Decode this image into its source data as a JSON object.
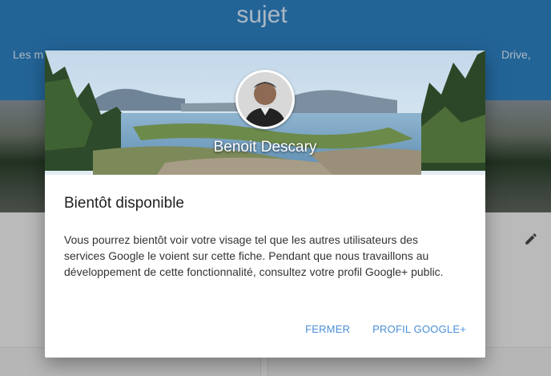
{
  "background": {
    "title": "sujet",
    "subtitle_fragment_left": "Les m",
    "subtitle_fragment_right": "Drive,"
  },
  "dialog": {
    "profile_name": "Benoit Descary",
    "title": "Bientôt disponible",
    "body": "Vous pourrez bientôt voir votre visage tel que les autres utilisateurs des services Google le voient sur cette fiche. Pendant que nous travaillons au développement de cette fonctionnalité, consultez votre profil Google+ public.",
    "buttons": {
      "close": "FERMER",
      "profile": "PROFIL GOOGLE+"
    }
  },
  "icons": [
    "edit-pencil-icon",
    "avatar-photo"
  ],
  "colors": {
    "header_blue": "#2b7ab9",
    "action_blue": "#4a90d9"
  }
}
